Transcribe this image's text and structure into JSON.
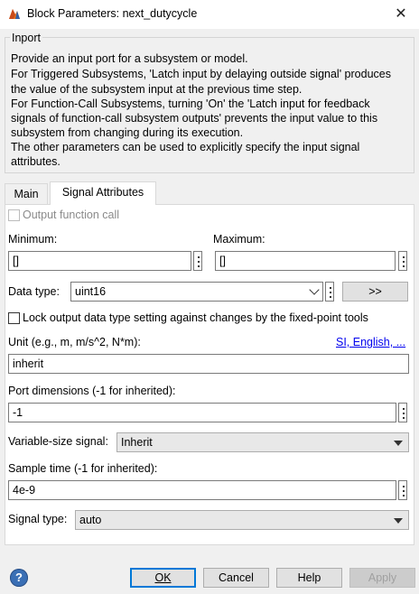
{
  "window": {
    "title": "Block Parameters: next_dutycycle",
    "close_glyph": "✕"
  },
  "block": {
    "group_label": "Inport",
    "description_lines": [
      "Provide an input port for a subsystem or model.",
      "For Triggered Subsystems, 'Latch input by delaying outside signal' produces",
      "the value of the subsystem input at the previous time step.",
      "For Function-Call Subsystems, turning 'On' the 'Latch input for feedback",
      "signals of function-call subsystem outputs' prevents the input value to this",
      "subsystem from changing during its execution.",
      "The other parameters can be used to explicitly specify the input signal",
      "attributes."
    ]
  },
  "tabs": [
    {
      "label": "Main",
      "active": false
    },
    {
      "label": "Signal Attributes",
      "active": true
    }
  ],
  "signal_attributes": {
    "output_function_call": {
      "label": "Output function call",
      "checked": false,
      "enabled": false
    },
    "minimum": {
      "label": "Minimum:",
      "value": "[]"
    },
    "maximum": {
      "label": "Maximum:",
      "value": "[]"
    },
    "data_type": {
      "label": "Data type:",
      "value": "uint16",
      "assistant_button": ">>"
    },
    "lock_output": {
      "label": "Lock output data type setting against changes by the fixed-point tools",
      "checked": false
    },
    "unit": {
      "label": "Unit (e.g., m, m/s^2, N*m):",
      "link": "SI, English, ...",
      "value": "inherit"
    },
    "port_dimensions": {
      "label": "Port dimensions (-1 for inherited):",
      "value": "-1"
    },
    "variable_size": {
      "label": "Variable-size signal:",
      "value": "Inherit"
    },
    "sample_time": {
      "label": "Sample time (-1 for inherited):",
      "value": "4e-9"
    },
    "signal_type": {
      "label": "Signal type:",
      "value": "auto"
    }
  },
  "buttons": {
    "help_glyph": "?",
    "ok": "OK",
    "cancel": "Cancel",
    "help": "Help",
    "apply": "Apply"
  },
  "colors": {
    "accent": "#0078d7",
    "link": "#0000ee",
    "help_icon": "#3a6fb5"
  }
}
